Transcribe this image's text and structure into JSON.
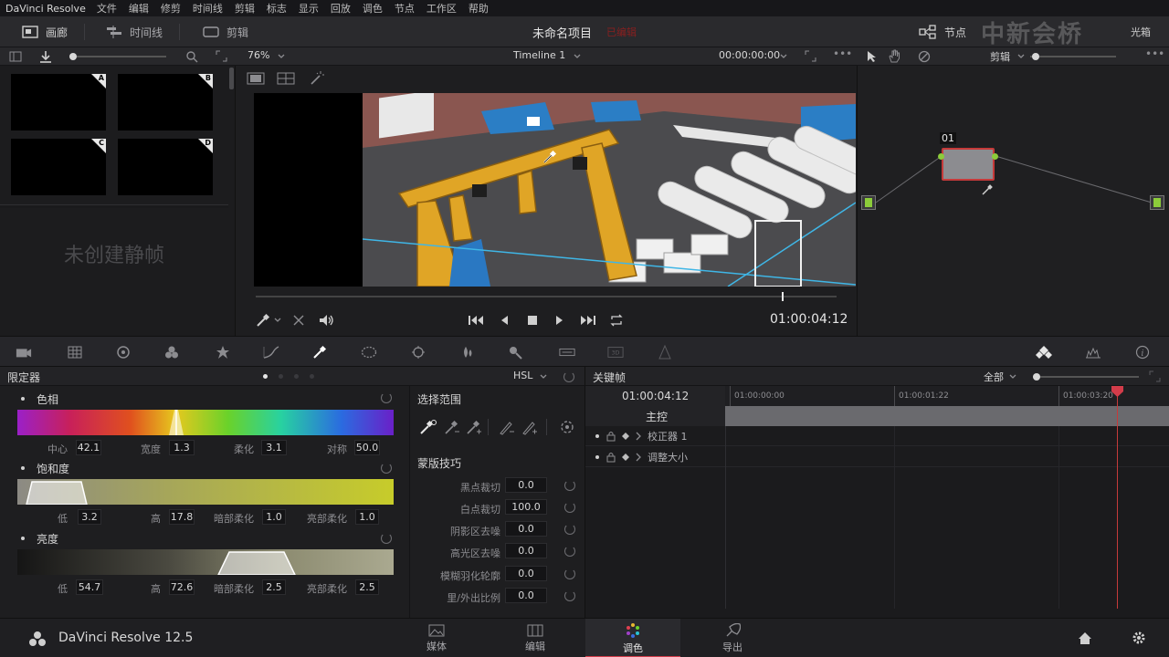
{
  "menubar": {
    "app": "DaVinci Resolve",
    "items": [
      "文件",
      "编辑",
      "修剪",
      "时间线",
      "剪辑",
      "标志",
      "显示",
      "回放",
      "调色",
      "节点",
      "工作区",
      "帮助"
    ]
  },
  "topbar": {
    "gallery": "画廊",
    "timeline": "时间线",
    "clips": "剪辑",
    "project_title": "未命名项目",
    "project_status": "已编辑",
    "nodes": "节点",
    "lightbox": "光箱",
    "watermark": "中新会桥"
  },
  "viewer_toolbar": {
    "zoom": "76%",
    "timeline_name": "Timeline 1",
    "timecode": "00:00:00:00"
  },
  "node_toolbar": {
    "mode": "剪辑"
  },
  "gallery": {
    "stills": [
      "A",
      "B",
      "C",
      "D"
    ],
    "empty_text": "未创建静帧"
  },
  "transport": {
    "timecode": "01:00:04:12",
    "playhead": 0.905
  },
  "node_editor": {
    "node_label": "01"
  },
  "qualifier": {
    "title": "限定器",
    "mode": "HSL",
    "hue": {
      "title": "色相",
      "center_label": "中心",
      "center": "42.1",
      "width_label": "宽度",
      "width": "1.3",
      "soft_label": "柔化",
      "soft": "3.1",
      "sym_label": "对称",
      "sym": "50.0"
    },
    "saturation": {
      "title": "饱和度",
      "low_label": "低",
      "low": "3.2",
      "high_label": "高",
      "high": "17.8",
      "lowsoft_label": "暗部柔化",
      "lowsoft": "1.0",
      "highsoft_label": "亮部柔化",
      "highsoft": "1.0"
    },
    "luminance": {
      "title": "亮度",
      "low_label": "低",
      "low": "54.7",
      "high_label": "高",
      "high": "72.6",
      "lowsoft_label": "暗部柔化",
      "lowsoft": "2.5",
      "highsoft_label": "亮部柔化",
      "highsoft": "2.5"
    }
  },
  "selection": {
    "title": "选择范围",
    "matte_title": "蒙版技巧",
    "rows": [
      {
        "label": "黑点裁切",
        "value": "0.0"
      },
      {
        "label": "白点裁切",
        "value": "100.0"
      },
      {
        "label": "阴影区去噪",
        "value": "0.0"
      },
      {
        "label": "高光区去噪",
        "value": "0.0"
      },
      {
        "label": "模糊羽化轮廓",
        "value": "0.0"
      },
      {
        "label": "里/外出比例",
        "value": "0.0"
      }
    ]
  },
  "keyframes": {
    "title": "关键帧",
    "filter": "全部",
    "timecode": "01:00:04:12",
    "master": "主控",
    "tracks": [
      "校正器 1",
      "调整大小"
    ],
    "ruler": [
      "01:00:00:00",
      "01:00:01:22",
      "01:00:03:20"
    ]
  },
  "bottombar": {
    "brand": "DaVinci Resolve 12.5",
    "nav": [
      "媒体",
      "编辑",
      "调色",
      "导出"
    ],
    "active": "调色"
  },
  "colors": {
    "accent": "#d33c4a",
    "node_green": "#8ccc3a",
    "node_border": "#c53a3a"
  }
}
